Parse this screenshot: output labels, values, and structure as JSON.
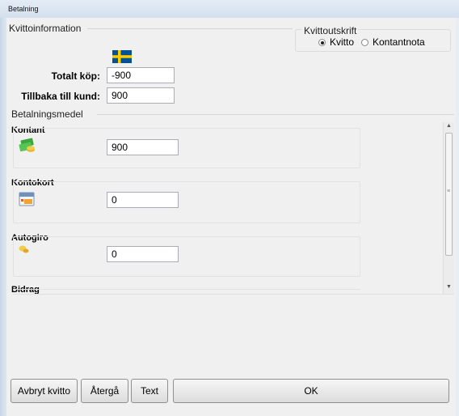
{
  "window": {
    "title": "Betalning"
  },
  "receipt_info": {
    "title": "Kvittoinformation",
    "total_label": "Totalt köp:",
    "total_value": "-900",
    "change_label": "Tillbaka till kund:",
    "change_value": "900"
  },
  "receipt_print": {
    "title": "Kvittoutskrift",
    "options": [
      {
        "label": "Kvitto",
        "selected": true
      },
      {
        "label": "Kontantnota",
        "selected": false
      }
    ]
  },
  "payment": {
    "title": "Betalningsmedel",
    "methods": [
      {
        "name": "Kontant",
        "value": "900",
        "icon": "cash-icon"
      },
      {
        "name": "Kontokort",
        "value": "0",
        "icon": "card-icon"
      },
      {
        "name": "Autogiro",
        "value": "0",
        "icon": "autogiro-icon"
      },
      {
        "name": "Bidrag"
      }
    ]
  },
  "buttons": {
    "cancel": "Avbryt kvitto",
    "back": "Återgå",
    "text": "Text",
    "ok": "OK"
  },
  "colors": {
    "flag_blue": "#005293",
    "flag_yellow": "#fecb00"
  }
}
